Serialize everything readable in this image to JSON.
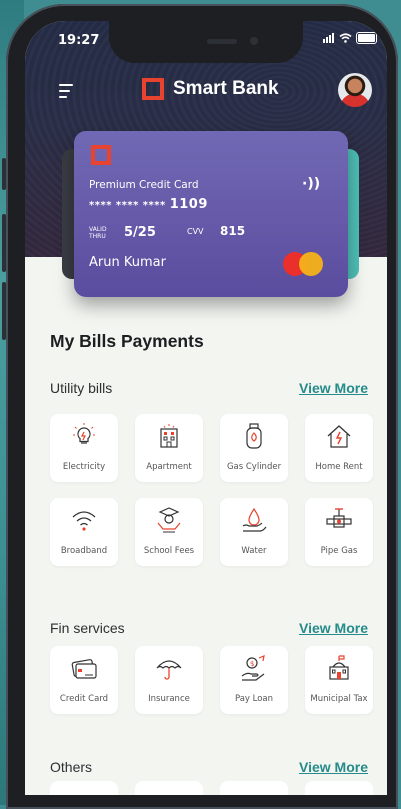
{
  "status_bar": {
    "time": "19:27"
  },
  "header": {
    "brand_name": "Smart Bank",
    "accent": "#e8432e"
  },
  "card": {
    "type_label": "Premium Credit Card",
    "masked_prefix": "**** **** ****",
    "last_four": "1109",
    "valid_thru_label": "VALID THRU",
    "valid_thru": "5/25",
    "cvv_label": "CVV",
    "cvv": "815",
    "holder": "Arun Kumar"
  },
  "section_title": "My Bills Payments",
  "groups": [
    {
      "title": "Utility bills",
      "view_more": "View More",
      "items": [
        {
          "label": "Electricity",
          "icon": "bulb-icon"
        },
        {
          "label": "Apartment",
          "icon": "apartment-icon"
        },
        {
          "label": "Gas Cylinder",
          "icon": "gas-cylinder-icon"
        },
        {
          "label": "Home Rent",
          "icon": "home-icon"
        },
        {
          "label": "Broadband",
          "icon": "wifi-icon"
        },
        {
          "label": "School Fees",
          "icon": "graduate-icon"
        },
        {
          "label": "Water",
          "icon": "water-drop-icon"
        },
        {
          "label": "Pipe Gas",
          "icon": "pipe-icon"
        }
      ]
    },
    {
      "title": "Fin services",
      "view_more": "View More",
      "items": [
        {
          "label": "Credit Card",
          "icon": "credit-card-icon"
        },
        {
          "label": "Insurance",
          "icon": "umbrella-icon"
        },
        {
          "label": "Pay Loan",
          "icon": "loan-icon"
        },
        {
          "label": "Municipal Tax",
          "icon": "municipal-icon"
        }
      ]
    },
    {
      "title": "Others",
      "view_more": "View More",
      "items": []
    }
  ],
  "colors": {
    "accent_red": "#e8432e",
    "link_teal": "#268b8a",
    "card_purple": "#6659a8"
  }
}
